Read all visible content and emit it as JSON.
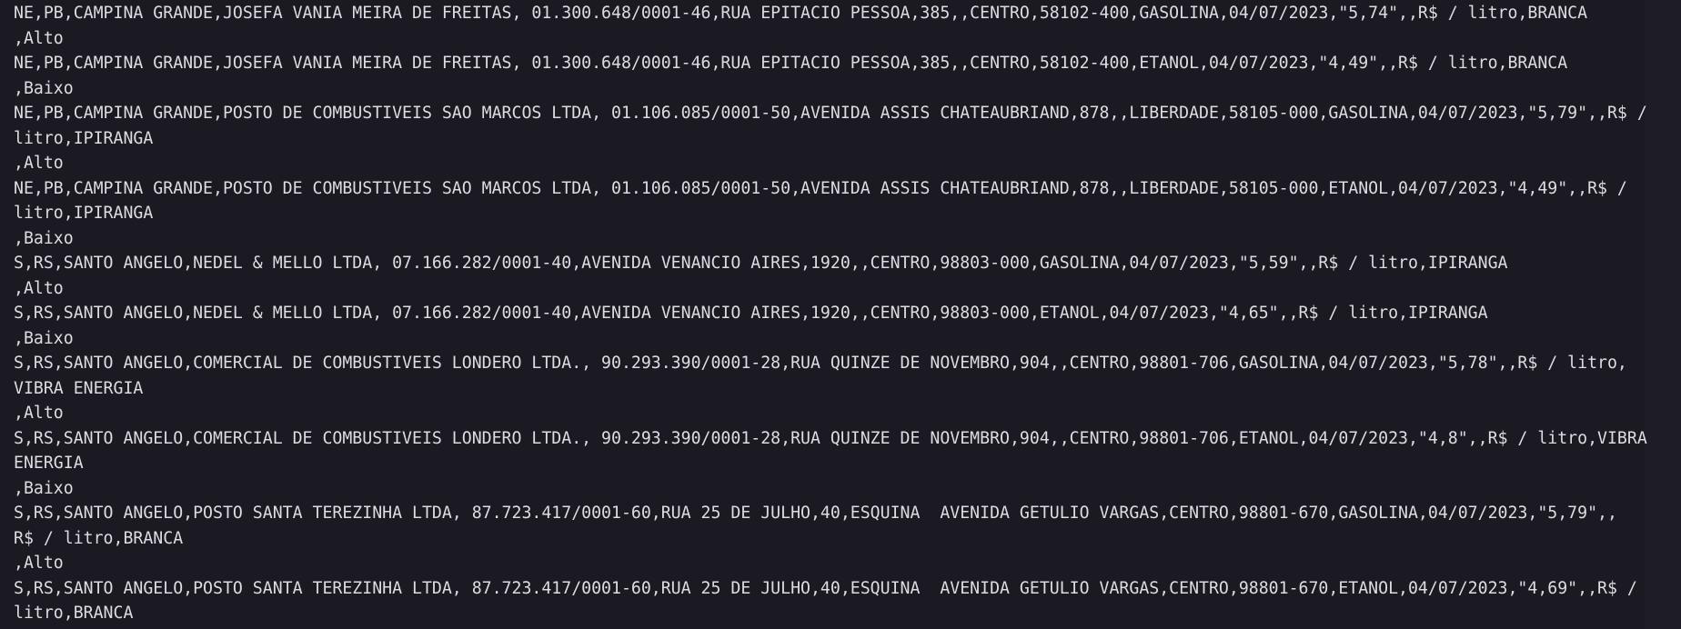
{
  "colors": {
    "background": "#1b1921",
    "text": "#dddce3"
  },
  "output": {
    "lines": [
      "NE,PB,CAMPINA GRANDE,JOSEFA VANIA MEIRA DE FREITAS, 01.300.648/0001-46,RUA EPITACIO PESSOA,385,,CENTRO,58102-400,GASOLINA,04/07/2023,\"5,74\",,R$ / litro,BRANCA",
      ",Alto",
      "NE,PB,CAMPINA GRANDE,JOSEFA VANIA MEIRA DE FREITAS, 01.300.648/0001-46,RUA EPITACIO PESSOA,385,,CENTRO,58102-400,ETANOL,04/07/2023,\"4,49\",,R$ / litro,BRANCA",
      ",Baixo",
      "NE,PB,CAMPINA GRANDE,POSTO DE COMBUSTIVEIS SAO MARCOS LTDA, 01.106.085/0001-50,AVENIDA ASSIS CHATEAUBRIAND,878,,LIBERDADE,58105-000,GASOLINA,04/07/2023,\"5,79\",,R$ /",
      "litro,IPIRANGA",
      ",Alto",
      "NE,PB,CAMPINA GRANDE,POSTO DE COMBUSTIVEIS SAO MARCOS LTDA, 01.106.085/0001-50,AVENIDA ASSIS CHATEAUBRIAND,878,,LIBERDADE,58105-000,ETANOL,04/07/2023,\"4,49\",,R$ /",
      "litro,IPIRANGA",
      ",Baixo",
      "S,RS,SANTO ANGELO,NEDEL & MELLO LTDA, 07.166.282/0001-40,AVENIDA VENANCIO AIRES,1920,,CENTRO,98803-000,GASOLINA,04/07/2023,\"5,59\",,R$ / litro,IPIRANGA",
      ",Alto",
      "S,RS,SANTO ANGELO,NEDEL & MELLO LTDA, 07.166.282/0001-40,AVENIDA VENANCIO AIRES,1920,,CENTRO,98803-000,ETANOL,04/07/2023,\"4,65\",,R$ / litro,IPIRANGA",
      ",Baixo",
      "S,RS,SANTO ANGELO,COMERCIAL DE COMBUSTIVEIS LONDERO LTDA., 90.293.390/0001-28,RUA QUINZE DE NOVEMBRO,904,,CENTRO,98801-706,GASOLINA,04/07/2023,\"5,78\",,R$ / litro,",
      "VIBRA ENERGIA",
      ",Alto",
      "S,RS,SANTO ANGELO,COMERCIAL DE COMBUSTIVEIS LONDERO LTDA., 90.293.390/0001-28,RUA QUINZE DE NOVEMBRO,904,,CENTRO,98801-706,ETANOL,04/07/2023,\"4,8\",,R$ / litro,VIBRA",
      "ENERGIA",
      ",Baixo",
      "S,RS,SANTO ANGELO,POSTO SANTA TEREZINHA LTDA, 87.723.417/0001-60,RUA 25 DE JULHO,40,ESQUINA  AVENIDA GETULIO VARGAS,CENTRO,98801-670,GASOLINA,04/07/2023,\"5,79\",,",
      "R$ / litro,BRANCA",
      ",Alto",
      "S,RS,SANTO ANGELO,POSTO SANTA TEREZINHA LTDA, 87.723.417/0001-60,RUA 25 DE JULHO,40,ESQUINA  AVENIDA GETULIO VARGAS,CENTRO,98801-670,ETANOL,04/07/2023,\"4,69\",,R$ /",
      "litro,BRANCA"
    ]
  }
}
